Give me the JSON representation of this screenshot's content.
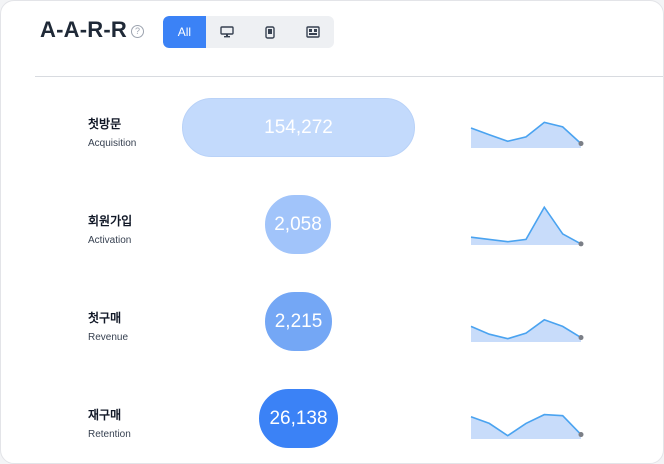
{
  "header": {
    "title": "A-A-R-R",
    "help_glyph": "?",
    "segments": [
      {
        "label": "All",
        "icon": null,
        "active": true
      },
      {
        "label": "",
        "icon": "desktop-icon",
        "active": false
      },
      {
        "label": "",
        "icon": "mobile-icon",
        "active": false
      },
      {
        "label": "",
        "icon": "app-icon",
        "active": false
      }
    ]
  },
  "metrics": [
    {
      "name_ko": "첫방문",
      "name_en": "Acquisition",
      "value": "154,272",
      "color": "#c3dafc",
      "border": "#b9d2f8",
      "trend": [
        18,
        12,
        6,
        10,
        23,
        19,
        4
      ]
    },
    {
      "name_ko": "회원가입",
      "name_en": "Activation",
      "value": "2,058",
      "color": "#a1c4fa",
      "border": "#a1c4fa",
      "trend": [
        7,
        5,
        3,
        5,
        34,
        10,
        1
      ]
    },
    {
      "name_ko": "첫구매",
      "name_en": "Revenue",
      "value": "2,215",
      "color": "#74a7f5",
      "border": "#74a7f5",
      "trend": [
        14,
        7,
        3,
        8,
        20,
        14,
        4
      ]
    },
    {
      "name_ko": "재구매",
      "name_en": "Retention",
      "value": "26,138",
      "color": "#3b82f6",
      "border": "#3b82f6",
      "trend": [
        20,
        14,
        3,
        14,
        22,
        21,
        4
      ]
    }
  ],
  "colors": {
    "accent": "#3b82f6",
    "spark_line": "#4aa3f0",
    "spark_fill": "#c8dcfa",
    "spark_dot": "#7b7f87"
  }
}
